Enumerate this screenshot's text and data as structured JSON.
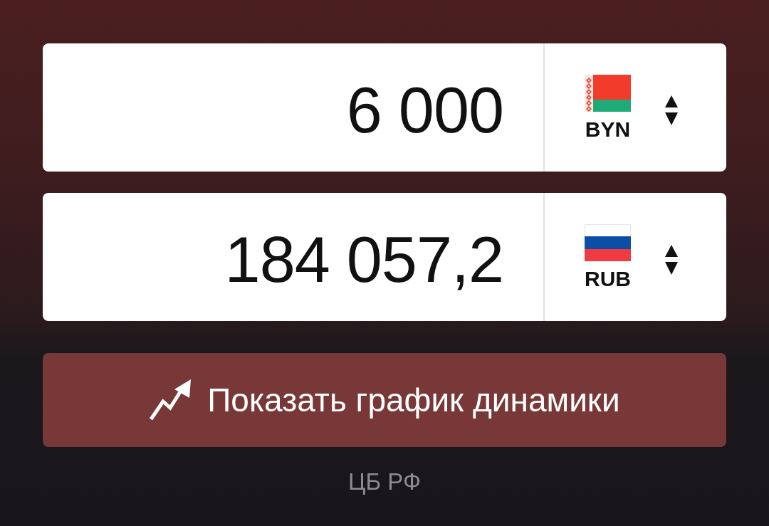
{
  "converter": {
    "rows": [
      {
        "amount": "6 000",
        "currency": "BYN",
        "kind": "belarus"
      },
      {
        "amount": "184 057,2",
        "currency": "RUB",
        "kind": "russia"
      }
    ]
  },
  "chart_button": {
    "label": "Показать график динамики"
  },
  "source": "ЦБ РФ"
}
